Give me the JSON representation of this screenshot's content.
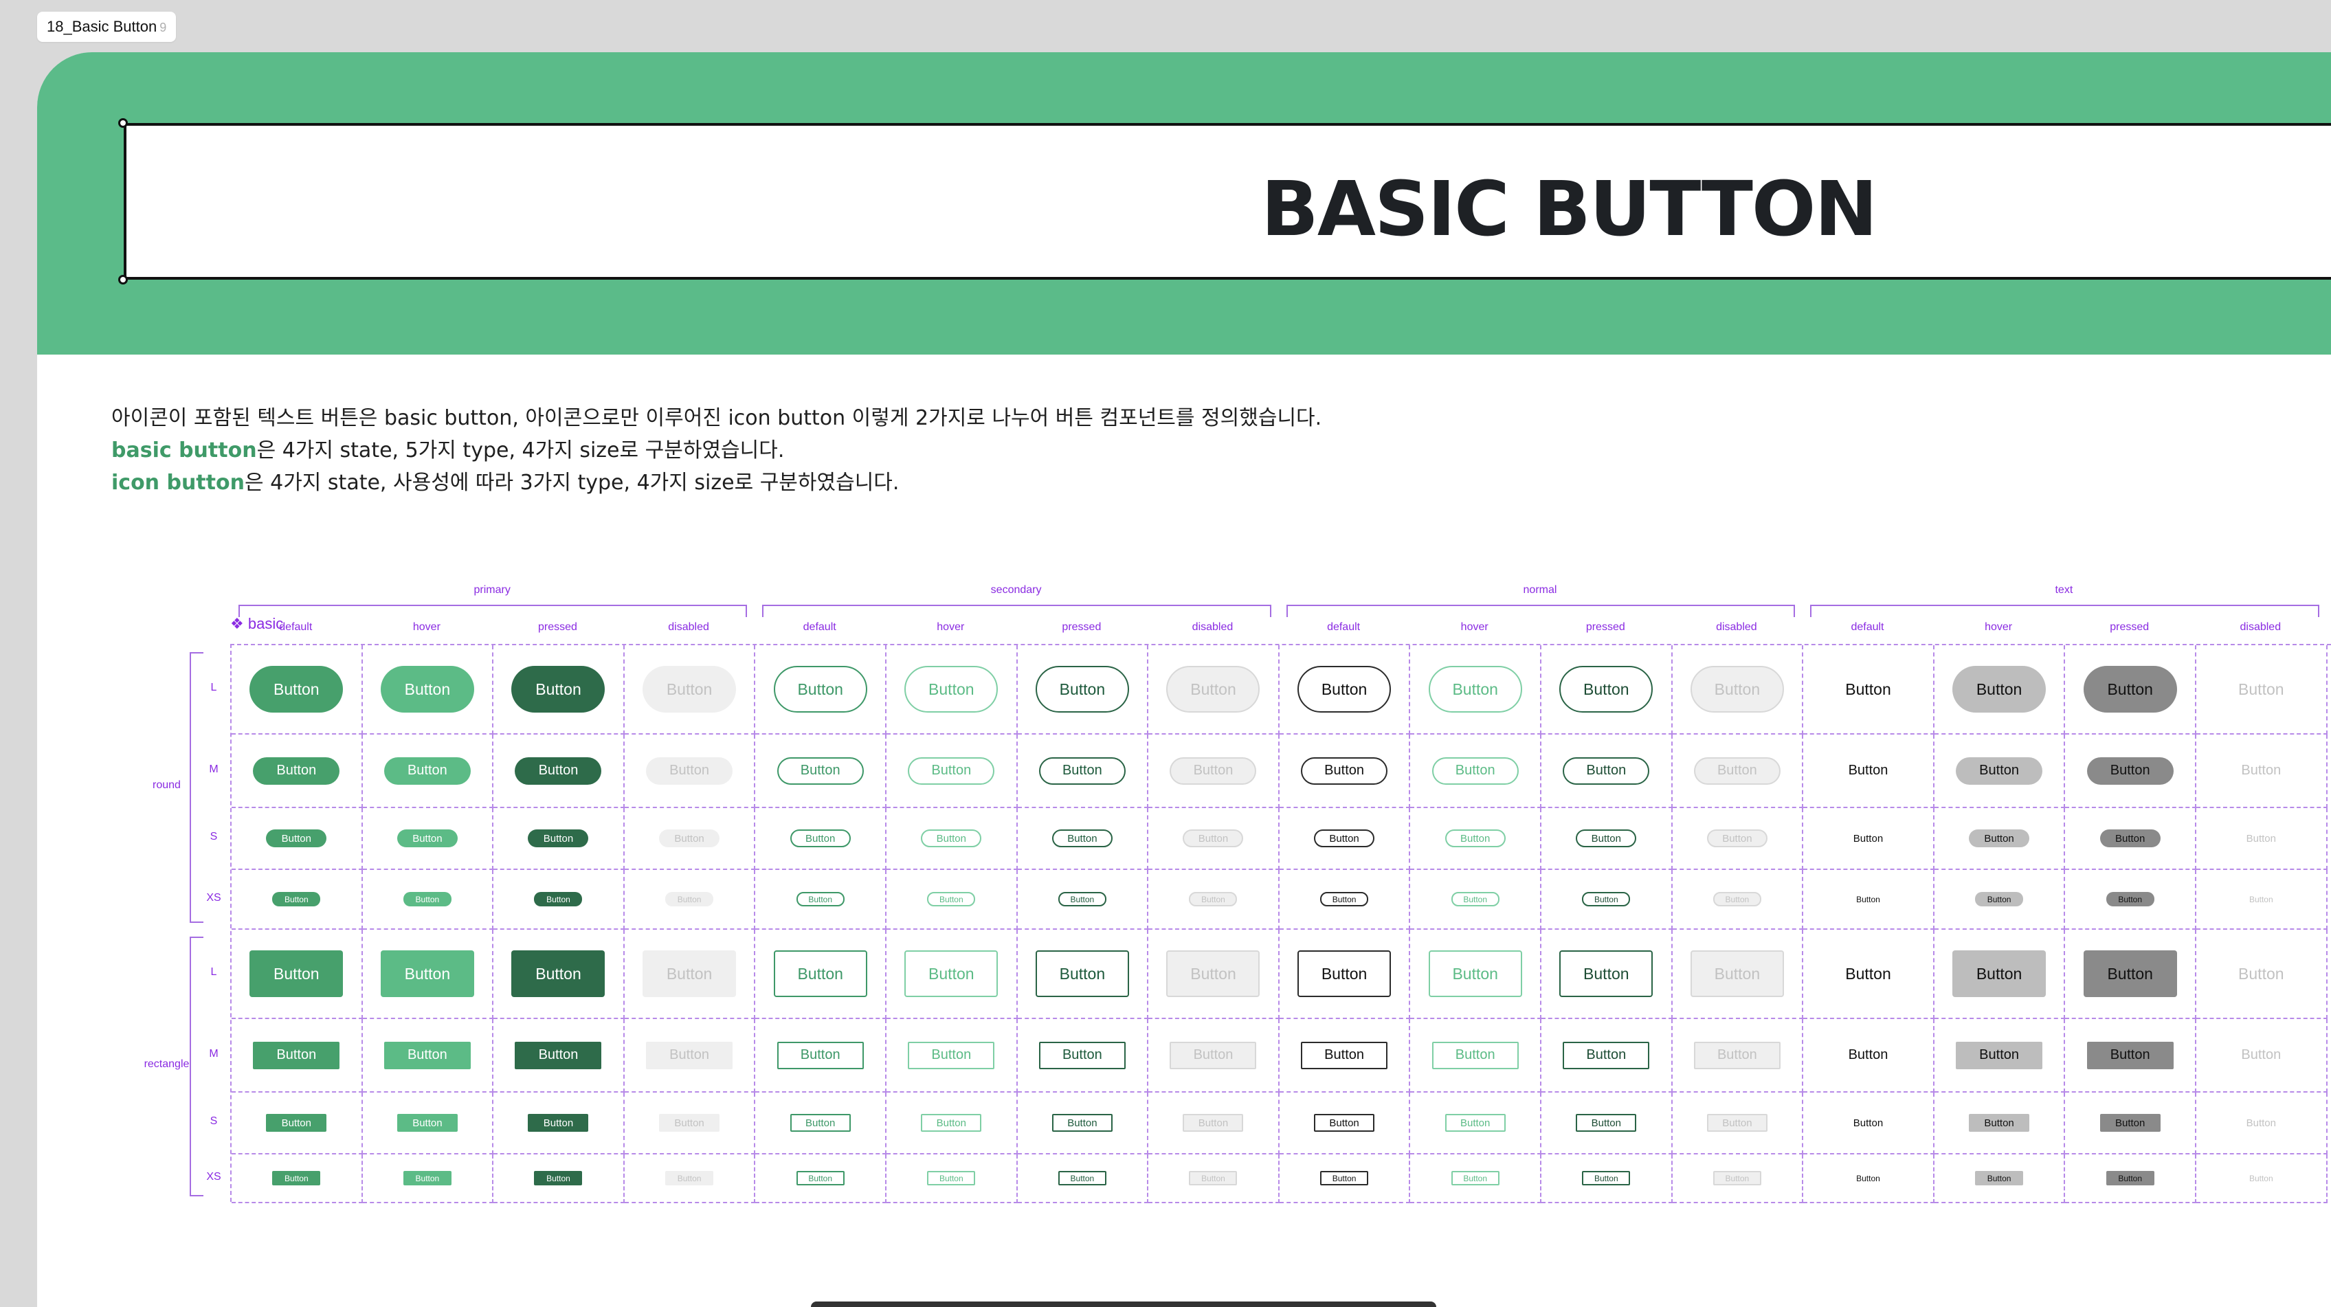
{
  "frame": {
    "label": "18_Basic Button",
    "ghost": "9"
  },
  "header": {
    "title": "BASIC BUTTON"
  },
  "description": {
    "line1": "아이콘이 포함된 텍스트 버튼은 basic button, 아이콘으로만 이루어진 icon button 이렇게 2가지로 나누어 버튼 컴포넌트를 정의했습니다.",
    "line2_highlight": "basic button",
    "line2_rest": "은 4가지 state, 5가지 type, 4가지 size로 구분하였습니다.",
    "line3_highlight": "icon button",
    "line3_rest": "은 4가지 state, 사용성에 따라 3가지 type, 4가지 size로 구분하였습니다."
  },
  "component": {
    "name": "basic",
    "icon": "component-icon"
  },
  "matrix": {
    "types": [
      "primary",
      "secondary",
      "normal",
      "text"
    ],
    "states": [
      "default",
      "hover",
      "pressed",
      "disabled"
    ],
    "shapes": [
      "round",
      "rectangle"
    ],
    "sizes": [
      "L",
      "M",
      "S",
      "XS"
    ],
    "button_label": "Button"
  },
  "colors": {
    "green_default": "#47a06c",
    "green_hover": "#5cbb86",
    "green_pressed": "#2e6b4a",
    "disabled_bg": "#efefef",
    "disabled_text": "#c2c2c2",
    "secondary_border": "#3e9868",
    "secondary_hover_border": "#7fcfa5",
    "secondary_pressed_border": "#2a6446",
    "normal_border": "#2b2b2b",
    "text_hover_bg": "#bdbdbd",
    "text_pressed_bg": "#8a8a8a",
    "annotation": "#8a2be2"
  }
}
